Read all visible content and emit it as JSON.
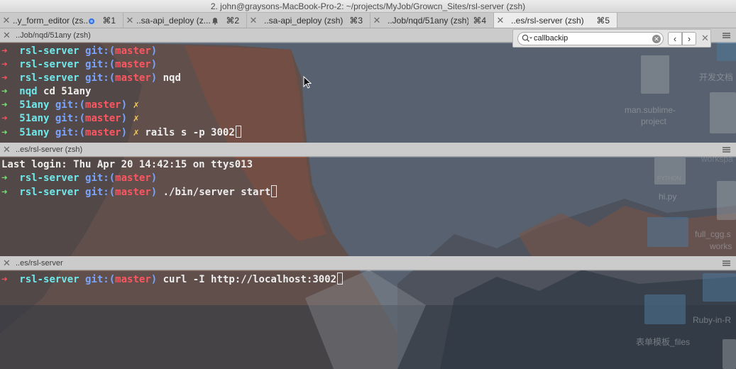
{
  "window": {
    "title": "2. john@graysons-MacBook-Pro-2: ~/projects/MyJob/Growcn_Sites/rsl-server (zsh)"
  },
  "tabs": [
    {
      "label": "..y_form_editor (zs...",
      "shortcut": "⌘1",
      "indicator": "blue-dot",
      "active": false
    },
    {
      "label": "..sa-api_deploy (z...",
      "shortcut": "⌘2",
      "indicator": "bell",
      "active": false
    },
    {
      "label": "..sa-api_deploy (zsh)",
      "shortcut": "⌘3",
      "indicator": "",
      "active": false
    },
    {
      "label": "..Job/nqd/51any (zsh)",
      "shortcut": "⌘4",
      "indicator": "",
      "active": false
    },
    {
      "label": "..es/rsl-server (zsh)",
      "shortcut": "⌘5",
      "indicator": "",
      "active": true
    }
  ],
  "find": {
    "query": "callbackip"
  },
  "panes": [
    {
      "header": "..Job/nqd/51any (zsh)",
      "lines": [
        [
          [
            "➜",
            "arrow-red"
          ],
          [
            "  rsl-server",
            "cyan"
          ],
          [
            " git:(",
            "blue"
          ],
          [
            "master",
            "red"
          ],
          [
            ")",
            "blue"
          ]
        ],
        [
          [
            "➜",
            "arrow-red"
          ],
          [
            "  rsl-server",
            "cyan"
          ],
          [
            " git:(",
            "blue"
          ],
          [
            "master",
            "red"
          ],
          [
            ")",
            "blue"
          ]
        ],
        [
          [
            "➜",
            "arrow-red"
          ],
          [
            "  rsl-server",
            "cyan"
          ],
          [
            " git:(",
            "blue"
          ],
          [
            "master",
            "red"
          ],
          [
            ")",
            "blue"
          ],
          [
            " nqd",
            "white"
          ]
        ],
        [
          [
            "➜",
            "arrow-green"
          ],
          [
            "  nqd",
            "cyan"
          ],
          [
            " cd 51any",
            "white"
          ]
        ],
        [
          [
            "➜",
            "arrow-green"
          ],
          [
            "  51any",
            "cyan"
          ],
          [
            " git:(",
            "blue"
          ],
          [
            "master",
            "red"
          ],
          [
            ")",
            "blue"
          ],
          [
            " ✗",
            "yellow"
          ]
        ],
        [
          [
            "➜",
            "arrow-red"
          ],
          [
            "  51any",
            "cyan"
          ],
          [
            " git:(",
            "blue"
          ],
          [
            "master",
            "red"
          ],
          [
            ")",
            "blue"
          ],
          [
            " ✗",
            "yellow"
          ]
        ],
        [
          [
            "➜",
            "arrow-green"
          ],
          [
            "  51any",
            "cyan"
          ],
          [
            " git:(",
            "blue"
          ],
          [
            "master",
            "red"
          ],
          [
            ")",
            "blue"
          ],
          [
            " ✗",
            "yellow"
          ],
          [
            " rails s -p 3002",
            "white"
          ]
        ]
      ],
      "cursor_line": 6
    },
    {
      "header": "..es/rsl-server (zsh)",
      "lines": [
        [
          [
            "Last login: Thu Apr 20 14:42:15 on ttys013",
            "white"
          ]
        ],
        [
          [
            "➜",
            "arrow-green"
          ],
          [
            "  rsl-server",
            "cyan"
          ],
          [
            " git:(",
            "blue"
          ],
          [
            "master",
            "red"
          ],
          [
            ")",
            "blue"
          ]
        ],
        [
          [
            "➜",
            "arrow-green"
          ],
          [
            "  rsl-server",
            "cyan"
          ],
          [
            " git:(",
            "blue"
          ],
          [
            "master",
            "red"
          ],
          [
            ")",
            "blue"
          ],
          [
            " ./bin/server start",
            "white"
          ]
        ]
      ],
      "cursor_line": 2
    },
    {
      "header": "..es/rsl-server",
      "lines": [
        [
          [
            "➜",
            "arrow-red"
          ],
          [
            "  rsl-server",
            "cyan"
          ],
          [
            " git:(",
            "blue"
          ],
          [
            "master",
            "red"
          ],
          [
            ")",
            "blue"
          ],
          [
            " curl -I http://localhost:3002",
            "white"
          ]
        ]
      ],
      "cursor_line": 0
    }
  ],
  "desktop": {
    "items": [
      {
        "label": "开发文档",
        "name": "desktop-item-dev-docs"
      },
      {
        "label": "man.sublime-",
        "name": "desktop-item-man-sublime-1"
      },
      {
        "label": "project",
        "name": "desktop-item-man-sublime-2"
      },
      {
        "label": "workspa",
        "name": "desktop-item-workspace"
      },
      {
        "label": "PYTHON",
        "name": "desktop-item-python-tag"
      },
      {
        "label": "hi.py",
        "name": "desktop-item-hi-py"
      },
      {
        "label": "full_cgg.s",
        "name": "desktop-item-full-cgg-1"
      },
      {
        "label": "works",
        "name": "desktop-item-full-cgg-2"
      },
      {
        "label": "Ruby-in-R",
        "name": "desktop-item-ruby-in-r"
      },
      {
        "label": "表单模板_files",
        "name": "desktop-item-form-template"
      }
    ]
  }
}
